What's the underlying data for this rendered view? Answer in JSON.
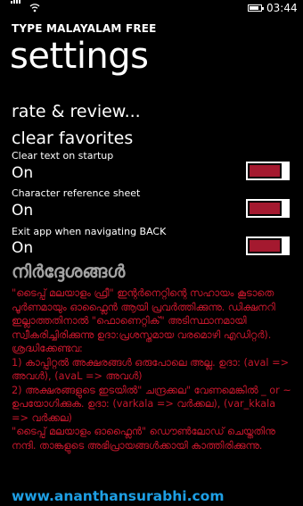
{
  "status_bar": {
    "time": "03:44",
    "battery_level": 0.8
  },
  "app_title": "TYPE MALAYALAM FREE",
  "page_title": "settings",
  "links": [
    {
      "label": "rate & review..."
    },
    {
      "label": "clear favorites"
    }
  ],
  "settings": [
    {
      "label": "Clear text on startup",
      "value": "On",
      "state": true
    },
    {
      "label": "Character reference sheet",
      "value": "On",
      "state": true
    },
    {
      "label": "Exit app when navigating BACK",
      "value": "On",
      "state": true
    }
  ],
  "instructions": {
    "title": "നിർദ്ദേശങ്ങൾ",
    "paragraphs": [
      "\"ടൈപ്പ് മലയാളം ഫ്രീ\" ഇന്റർനെറ്റിന്റെ സഹായം കൂടാതെ പൂർണമായും ഓഫ്ലൈൻ ആയി പ്രവർത്തിക്കുന്നു. ഡിക്ഷനറി ഇല്ലാത്തതിനാൽ \"ഫൊണെറ്റിക്\" അടിസ്ഥാനമായി സ്വീകരിച്ചിരിക്കുന്നു ഉദാ:പ്രശസ്തമായ വരമൊഴി എഡിറ്റർ). ശ്രദ്ധിക്കേണ്ടവ:",
      "1) കാപ്പിറ്റൽ അക്ഷരങ്ങൾ ഒരുപോലെ അല്ല. ഉദാ: (aval => അവൾ), (avaL => അവൾ)",
      "2) അക്ഷരങ്ങളുടെ ഇടയിൽ\" ചന്ദ്രക്കല\" വേണമെങ്കിൽ _ or ~ ഉപയോഗിക്കുക. ഉദാ: (varkala => വർക്കല), (var_kkala => വർക്കല)",
      "\"ടൈപ്പ് മലയാളം ഓഫ്ലൈൻ\" ഡൌൺലോഡ് ചെയ്തതിനു നന്ദി. താങ്കളുടെ അഭിപ്രായങ്ങൾക്കായി കാത്തിരിക്കുന്നു."
    ]
  },
  "website": "www.ananthansurabhi.com",
  "colors": {
    "accent": "#a4192f",
    "instructions_title": "#a3a3a3",
    "instructions_body": "#c4172c",
    "website": "#1e9fe4"
  }
}
